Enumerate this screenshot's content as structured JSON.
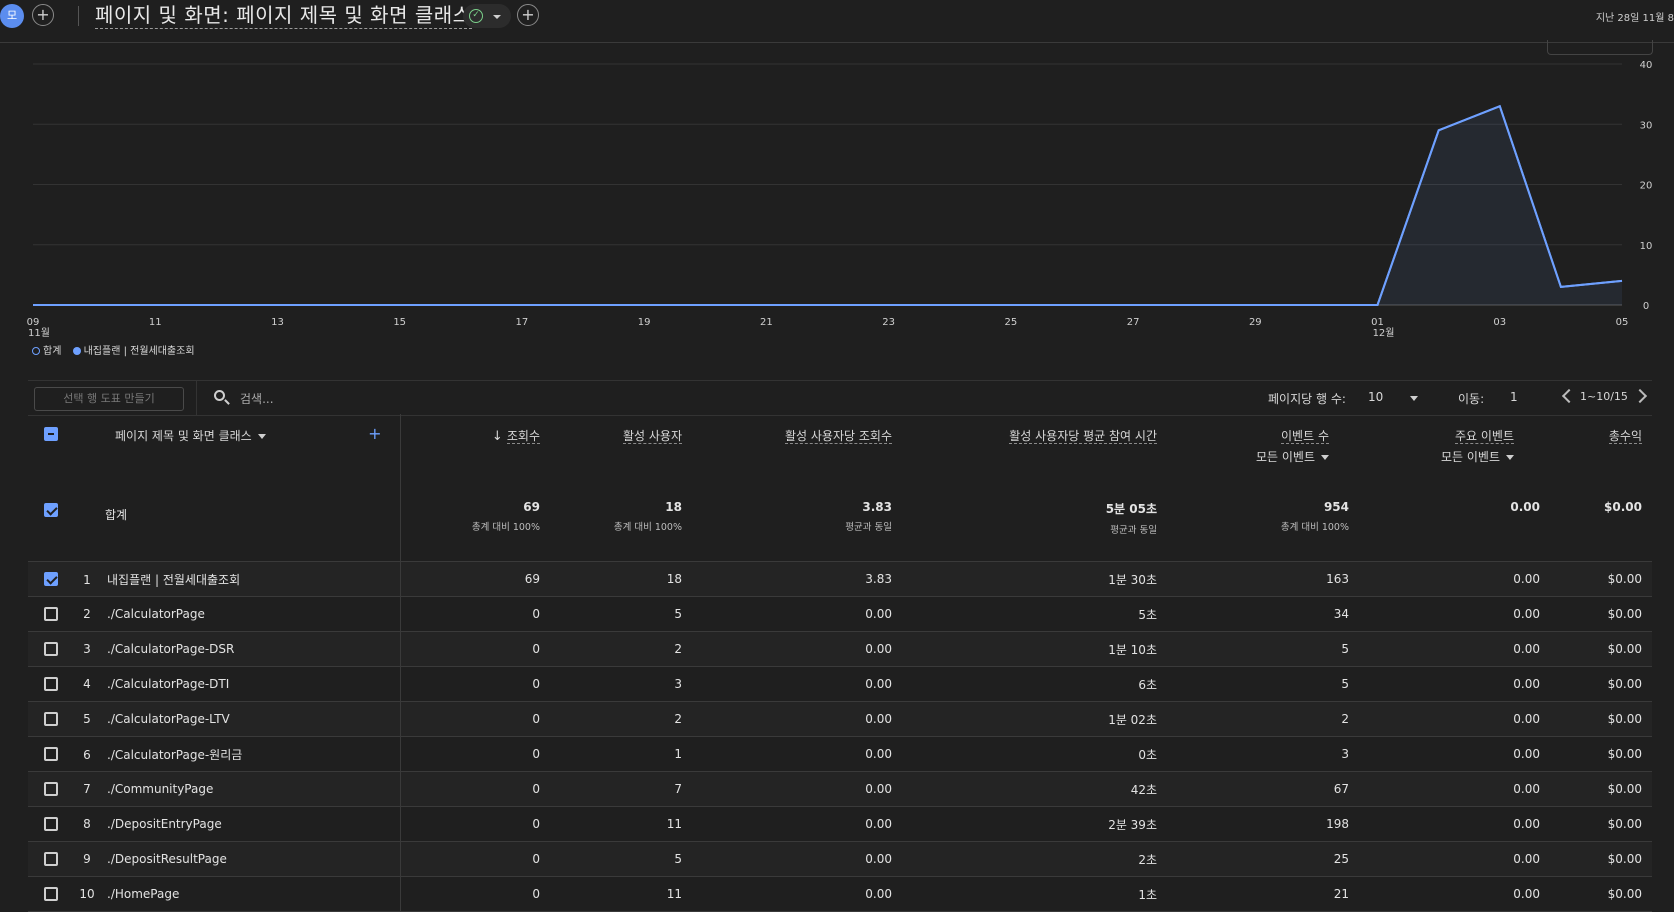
{
  "header": {
    "avatar_letter": "모",
    "title": "페이지 및 화면: 페이지 제목 및 화면 클래스",
    "date_range": "지난 28일  11월 8"
  },
  "chart_data": {
    "type": "line",
    "x": [
      "11-09",
      "11-10",
      "11-11",
      "11-12",
      "11-13",
      "11-14",
      "11-15",
      "11-16",
      "11-17",
      "11-18",
      "11-19",
      "11-20",
      "11-21",
      "11-22",
      "11-23",
      "11-24",
      "11-25",
      "11-26",
      "11-27",
      "11-28",
      "11-29",
      "11-30",
      "12-01",
      "12-02",
      "12-03",
      "12-04",
      "12-05"
    ],
    "series": [
      {
        "name": "합계",
        "values": [
          0,
          0,
          0,
          0,
          0,
          0,
          0,
          0,
          0,
          0,
          0,
          0,
          0,
          0,
          0,
          0,
          0,
          0,
          0,
          0,
          0,
          0,
          0,
          29,
          33,
          3,
          4
        ]
      },
      {
        "name": "내집플랜 | 전월세대출조회",
        "values": [
          0,
          0,
          0,
          0,
          0,
          0,
          0,
          0,
          0,
          0,
          0,
          0,
          0,
          0,
          0,
          0,
          0,
          0,
          0,
          0,
          0,
          0,
          0,
          29,
          33,
          3,
          4
        ]
      }
    ],
    "x_tick_labels": [
      "09",
      "11",
      "13",
      "15",
      "17",
      "19",
      "21",
      "23",
      "25",
      "27",
      "29",
      "01",
      "03",
      "05"
    ],
    "x_month_labels": {
      "09": "11월",
      "01": "12월"
    },
    "y_ticks": [
      0,
      10,
      20,
      30,
      40
    ],
    "ylim": [
      0,
      40
    ],
    "grid": true,
    "legend_placement": "bottom-left",
    "line_color": "#6ea0ff"
  },
  "toolbar": {
    "plot_rows_label": "선택 행 도표 만들기",
    "search_placeholder": "검색...",
    "rows_per_page_label": "페이지당 행 수:",
    "rows_per_page_value": "10",
    "goto_label": "이동:",
    "goto_value": "1",
    "pagination": "1~10/15"
  },
  "table": {
    "headers": {
      "dimension": "페이지 제목 및 화면 클래스",
      "views": "조회수",
      "active_users": "활성 사용자",
      "views_per_user": "활성 사용자당 조회수",
      "avg_engagement": "활성 사용자당 평균 참여 시간",
      "event_count": "이벤트 수",
      "event_count_sub": "모든 이벤트",
      "key_events": "주요 이벤트",
      "key_events_sub": "모든 이벤트",
      "revenue": "총수익"
    },
    "total": {
      "label": "합계",
      "views": "69",
      "views_sub": "총계 대비 100%",
      "active_users": "18",
      "active_users_sub": "총계 대비 100%",
      "views_per_user": "3.83",
      "views_per_user_sub": "평균과 동일",
      "avg_engagement": "5분 05초",
      "avg_engagement_sub": "평균과 동일",
      "event_count": "954",
      "event_count_sub": "총계 대비 100%",
      "key_events": "0.00",
      "revenue": "$0.00"
    },
    "rows": [
      {
        "rank": "1",
        "name": "내집플랜 | 전월세대출조회",
        "views": "69",
        "users": "18",
        "vpu": "3.83",
        "eng": "1분 30초",
        "events": "163",
        "key": "0.00",
        "rev": "$0.00",
        "checked": true
      },
      {
        "rank": "2",
        "name": "./CalculatorPage",
        "views": "0",
        "users": "5",
        "vpu": "0.00",
        "eng": "5초",
        "events": "34",
        "key": "0.00",
        "rev": "$0.00",
        "checked": false
      },
      {
        "rank": "3",
        "name": "./CalculatorPage-DSR",
        "views": "0",
        "users": "2",
        "vpu": "0.00",
        "eng": "1분 10초",
        "events": "5",
        "key": "0.00",
        "rev": "$0.00",
        "checked": false
      },
      {
        "rank": "4",
        "name": "./CalculatorPage-DTI",
        "views": "0",
        "users": "3",
        "vpu": "0.00",
        "eng": "6초",
        "events": "5",
        "key": "0.00",
        "rev": "$0.00",
        "checked": false
      },
      {
        "rank": "5",
        "name": "./CalculatorPage-LTV",
        "views": "0",
        "users": "2",
        "vpu": "0.00",
        "eng": "1분 02초",
        "events": "2",
        "key": "0.00",
        "rev": "$0.00",
        "checked": false
      },
      {
        "rank": "6",
        "name": "./CalculatorPage-원리금",
        "views": "0",
        "users": "1",
        "vpu": "0.00",
        "eng": "0초",
        "events": "3",
        "key": "0.00",
        "rev": "$0.00",
        "checked": false
      },
      {
        "rank": "7",
        "name": "./CommunityPage",
        "views": "0",
        "users": "7",
        "vpu": "0.00",
        "eng": "42초",
        "events": "67",
        "key": "0.00",
        "rev": "$0.00",
        "checked": false
      },
      {
        "rank": "8",
        "name": "./DepositEntryPage",
        "views": "0",
        "users": "11",
        "vpu": "0.00",
        "eng": "2분 39초",
        "events": "198",
        "key": "0.00",
        "rev": "$0.00",
        "checked": false
      },
      {
        "rank": "9",
        "name": "./DepositResultPage",
        "views": "0",
        "users": "5",
        "vpu": "0.00",
        "eng": "2초",
        "events": "25",
        "key": "0.00",
        "rev": "$0.00",
        "checked": false
      },
      {
        "rank": "10",
        "name": "./HomePage",
        "views": "0",
        "users": "11",
        "vpu": "0.00",
        "eng": "1초",
        "events": "21",
        "key": "0.00",
        "rev": "$0.00",
        "checked": false
      }
    ]
  }
}
